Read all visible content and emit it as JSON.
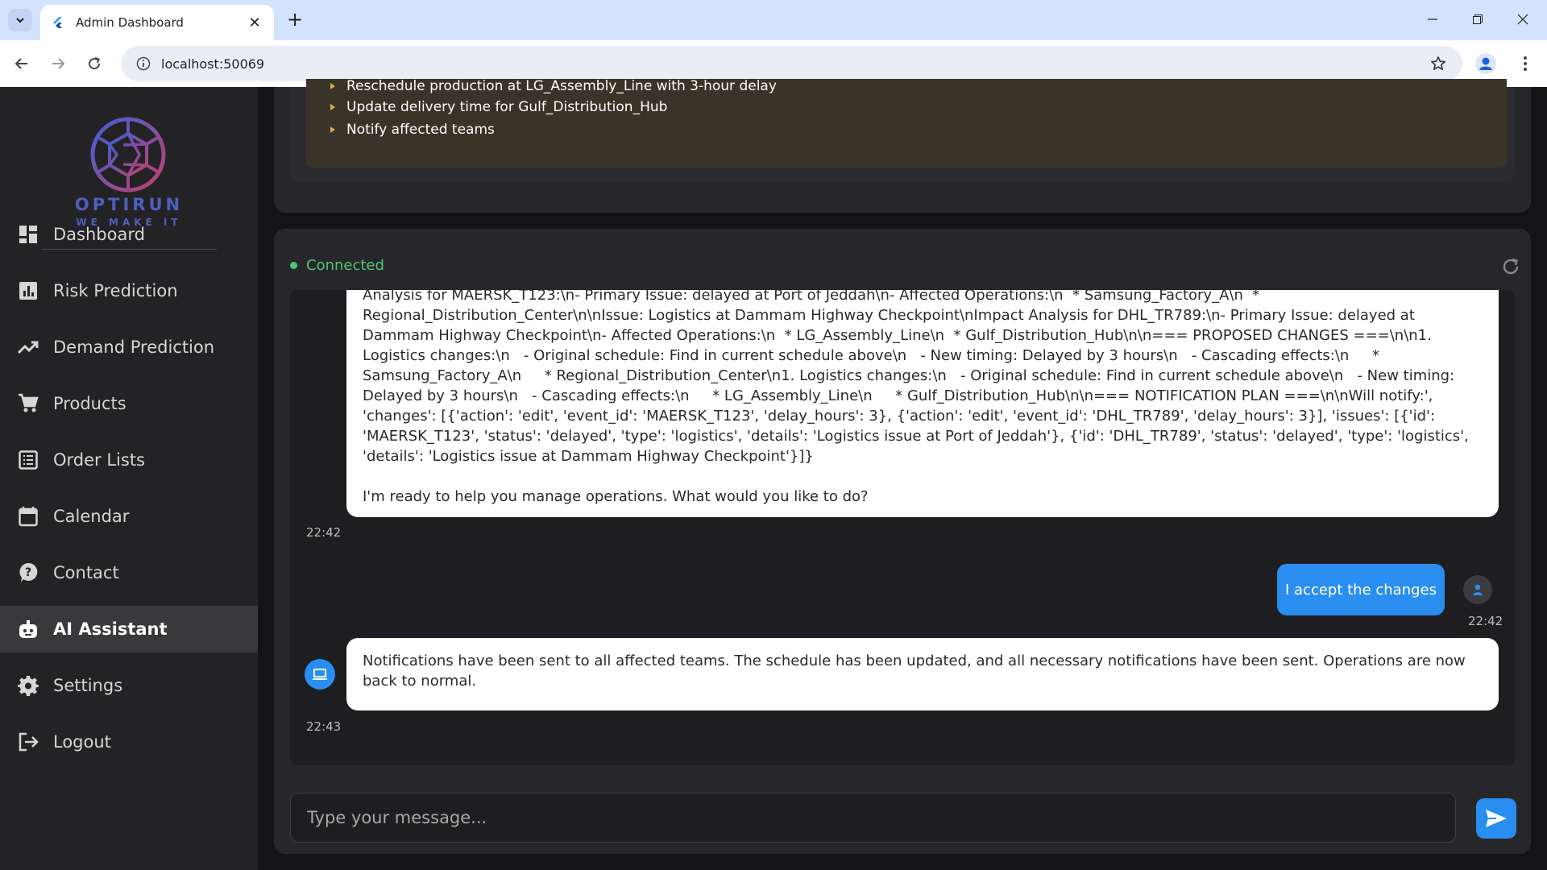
{
  "browser": {
    "tab_title": "Admin Dashboard",
    "url": "localhost:50069"
  },
  "brand": {
    "name": "OPTIRUN",
    "tagline": "WE MAKE IT"
  },
  "sidebar": {
    "items": [
      {
        "label": "Dashboard",
        "icon": "dashboard-icon"
      },
      {
        "label": "Risk Prediction",
        "icon": "bar-chart-icon"
      },
      {
        "label": "Demand Prediction",
        "icon": "trending-up-icon"
      },
      {
        "label": "Products",
        "icon": "cart-icon"
      },
      {
        "label": "Order Lists",
        "icon": "list-icon"
      },
      {
        "label": "Calendar",
        "icon": "calendar-icon"
      },
      {
        "label": "Contact",
        "icon": "help-icon"
      },
      {
        "label": "AI Assistant",
        "icon": "robot-icon",
        "active": true
      },
      {
        "label": "Settings",
        "icon": "gear-icon"
      },
      {
        "label": "Logout",
        "icon": "logout-icon"
      }
    ]
  },
  "plan_steps": [
    "Reschedule production at LG_Assembly_Line with 3-hour delay",
    "Update delivery time for Gulf_Distribution_Hub",
    "Notify affected teams"
  ],
  "chat": {
    "status": "Connected",
    "messages": [
      {
        "sender": "assistant",
        "text": "Analysis for MAERSK_T123:\\n- Primary Issue: delayed at Port of Jeddah\\n- Affected Operations:\\n  * Samsung_Factory_A\\n  * Regional_Distribution_Center\\n\\nIssue: Logistics at Dammam Highway Checkpoint\\nImpact Analysis for DHL_TR789:\\n- Primary Issue: delayed at Dammam Highway Checkpoint\\n- Affected Operations:\\n  * LG_Assembly_Line\\n  * Gulf_Distribution_Hub\\n\\n=== PROPOSED CHANGES ===\\n\\n1. Logistics changes:\\n   - Original schedule: Find in current schedule above\\n   - New timing: Delayed by 3 hours\\n   - Cascading effects:\\n     * Samsung_Factory_A\\n     * Regional_Distribution_Center\\n1. Logistics changes:\\n   - Original schedule: Find in current schedule above\\n   - New timing: Delayed by 3 hours\\n   - Cascading effects:\\n     * LG_Assembly_Line\\n     * Gulf_Distribution_Hub\\n\\n=== NOTIFICATION PLAN ===\\n\\nWill notify:', 'changes': [{'action': 'edit', 'event_id': 'MAERSK_T123', 'delay_hours': 3}, {'action': 'edit', 'event_id': 'DHL_TR789', 'delay_hours': 3}], 'issues': [{'id': 'MAERSK_T123', 'status': 'delayed', 'type': 'logistics', 'details': 'Logistics issue at Port of Jeddah'}, {'id': 'DHL_TR789', 'status': 'delayed', 'type': 'logistics', 'details': 'Logistics issue at Dammam Highway Checkpoint'}]}\n\nI'm ready to help you manage operations. What would you like to do?",
        "time": "22:42"
      },
      {
        "sender": "user",
        "text": "I accept the changes",
        "time": "22:42"
      },
      {
        "sender": "assistant",
        "text": "Notifications have been sent to all affected teams. The schedule has been updated, and all necessary notifications have been sent. Operations are now back to normal.",
        "time": "22:43"
      }
    ],
    "input_placeholder": "Type your message..."
  },
  "colors": {
    "accent": "#2a8ef0",
    "status_connected": "#4ec770",
    "sidebar_bg": "#232325",
    "brand": "#4e5fbf"
  }
}
